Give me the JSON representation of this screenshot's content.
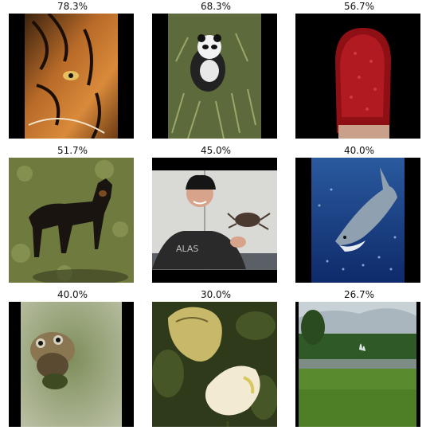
{
  "panels": [
    {
      "score": "78.3%",
      "subject": "tiger"
    },
    {
      "score": "68.3%",
      "subject": "panda"
    },
    {
      "score": "56.7%",
      "subject": "match-head"
    },
    {
      "score": "51.7%",
      "subject": "dog"
    },
    {
      "score": "45.0%",
      "subject": "man-with-crab"
    },
    {
      "score": "40.0%",
      "subject": "shark"
    },
    {
      "score": "40.0%",
      "subject": "frog"
    },
    {
      "score": "30.0%",
      "subject": "butterfly"
    },
    {
      "score": "26.7%",
      "subject": "fountain-landscape"
    }
  ]
}
